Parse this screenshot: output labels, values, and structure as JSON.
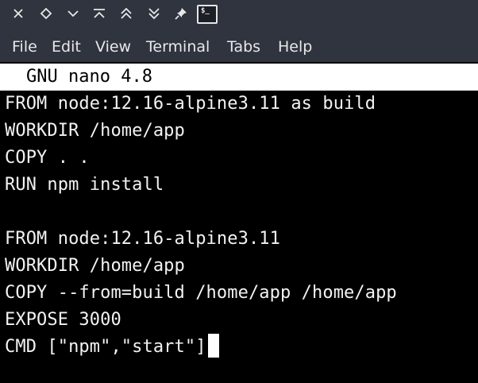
{
  "titlebar": {
    "buttons": [
      {
        "icon": "close-icon"
      },
      {
        "icon": "diamond-icon"
      },
      {
        "icon": "chevron-down-icon"
      },
      {
        "icon": "chevron-up-bar-icon"
      },
      {
        "icon": "double-chevron-up-icon"
      },
      {
        "icon": "double-chevron-down-icon"
      },
      {
        "icon": "pin-icon"
      }
    ],
    "app_icon": "terminal-icon",
    "app_icon_glyph": "$_"
  },
  "menu": {
    "file": "File",
    "edit": "Edit",
    "view": "View",
    "terminal": "Terminal",
    "tabs": "Tabs",
    "help": "Help"
  },
  "nano": {
    "header": "GNU nano 4.8"
  },
  "editor": {
    "lines": [
      "FROM node:12.16-alpine3.11 as build",
      "WORKDIR /home/app",
      "COPY . .",
      "RUN npm install",
      "",
      "FROM node:12.16-alpine3.11",
      "WORKDIR /home/app",
      "COPY --from=build /home/app /home/app",
      "EXPOSE 3000",
      "CMD [\"npm\",\"start\"]"
    ]
  },
  "colors": {
    "chrome": "#2f343f",
    "terminal_bg": "#000000",
    "terminal_fg": "#f2f2f2",
    "header_bg": "#ffffff"
  }
}
